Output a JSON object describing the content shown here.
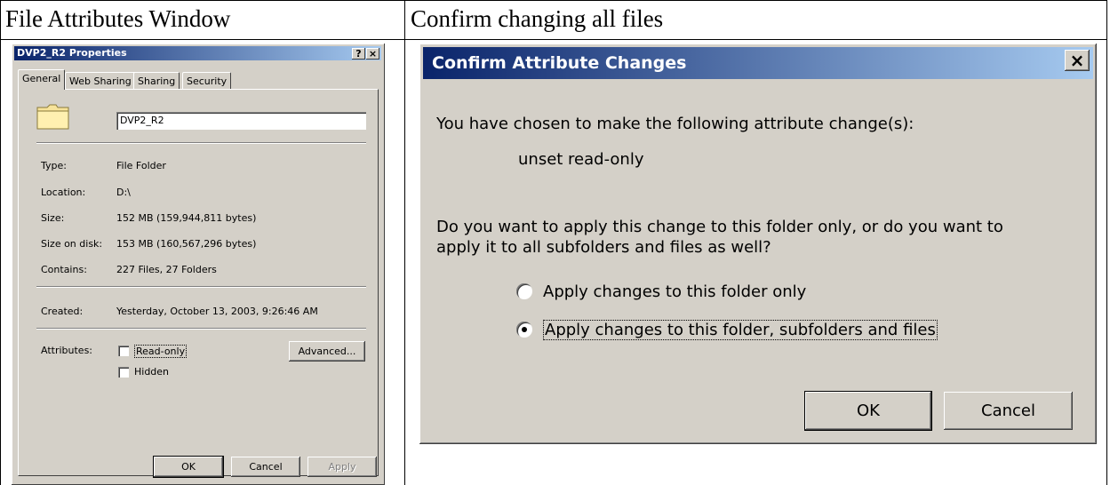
{
  "headings": {
    "left": "File Attributes Window",
    "right": "Confirm changing all files"
  },
  "properties_dialog": {
    "title": "DVP2_R2 Properties",
    "help_button": "?",
    "close_button": "×",
    "tabs": [
      "General",
      "Web Sharing",
      "Sharing",
      "Security"
    ],
    "name_value": "DVP2_R2",
    "fields": {
      "type_label": "Type:",
      "type_value": "File Folder",
      "location_label": "Location:",
      "location_value": "D:\\",
      "size_label": "Size:",
      "size_value": "152 MB (159,944,811 bytes)",
      "size_on_disk_label": "Size on disk:",
      "size_on_disk_value": "153 MB (160,567,296 bytes)",
      "contains_label": "Contains:",
      "contains_value": "227 Files, 27 Folders",
      "created_label": "Created:",
      "created_value": "Yesterday, October 13, 2003, 9:26:46 AM",
      "attributes_label": "Attributes:"
    },
    "checkboxes": {
      "readonly_label": "Read-only",
      "hidden_label": "Hidden"
    },
    "buttons": {
      "advanced": "Advanced...",
      "ok": "OK",
      "cancel": "Cancel",
      "apply": "Apply"
    }
  },
  "confirm_dialog": {
    "title": "Confirm Attribute Changes",
    "close_button": "×",
    "intro": "You have chosen to make the following attribute change(s):",
    "change": "unset read-only",
    "question_line1": "Do you want to apply this change to this folder only, or do you want to",
    "question_line2": "apply it to all subfolders and files as well?",
    "option_folder_only": "Apply changes to this folder only",
    "option_all": "Apply changes to this folder, subfolders and files",
    "selected_option": "option_all",
    "buttons": {
      "ok": "OK",
      "cancel": "Cancel"
    }
  }
}
